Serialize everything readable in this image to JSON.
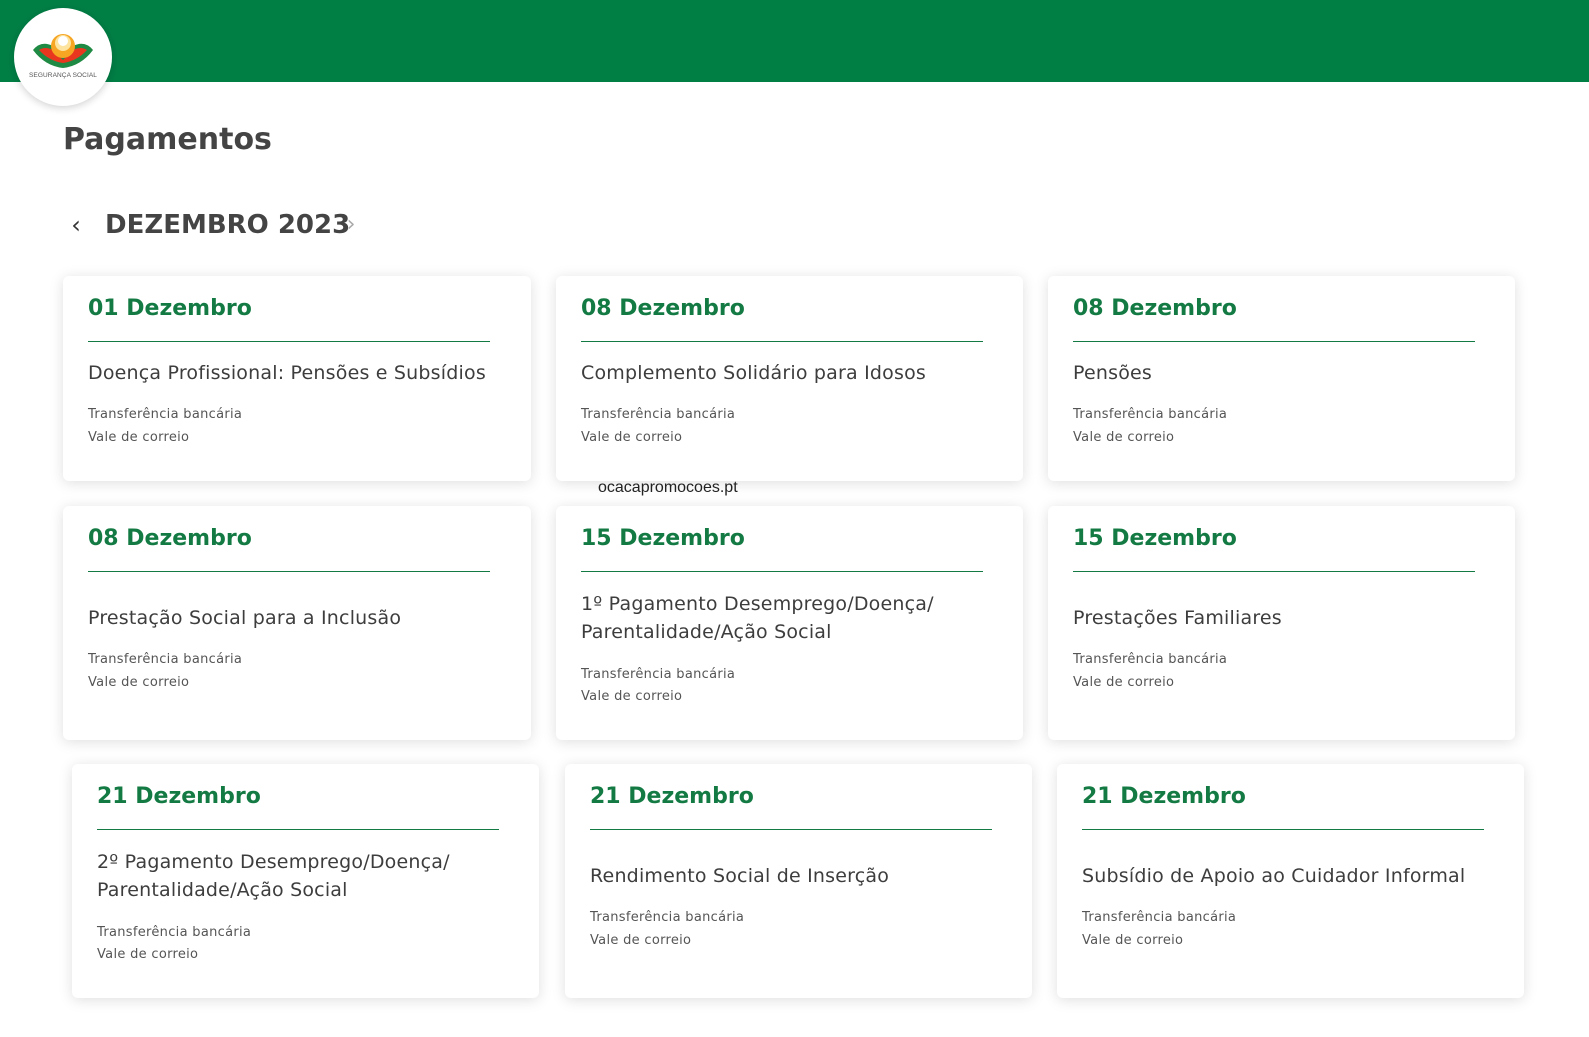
{
  "header": {
    "logo_text": "SEGURANÇA SOCIAL"
  },
  "page_title": "Pagamentos",
  "month_nav": {
    "prev_icon": "chevron-left-icon",
    "next_icon": "chevron-right-icon",
    "prev_glyph": "‹",
    "next_glyph": "›",
    "label": "DEZEMBRO 2023"
  },
  "watermark": "ocacapromocoes.pt",
  "colors": {
    "header_green": "#007f45",
    "accent_green": "#137a43"
  },
  "cards": [
    {
      "date": "01 Dezembro",
      "title": "Doença Profissional: Pensões e Subsídios",
      "methods": [
        "Transferência bancária",
        "Vale de correio"
      ]
    },
    {
      "date": "08 Dezembro",
      "title": "Complemento Solidário para Idosos",
      "methods": [
        "Transferência bancária",
        "Vale de correio"
      ]
    },
    {
      "date": "08 Dezembro",
      "title": "Pensões",
      "methods": [
        "Transferência bancária",
        "Vale de correio"
      ]
    },
    {
      "date": "08 Dezembro",
      "title": "Prestação Social para a Inclusão",
      "methods": [
        "Transferência bancária",
        "Vale de correio"
      ]
    },
    {
      "date": "15 Dezembro",
      "title": "1º Pagamento Desemprego/Doença/ Parentalidade/Ação Social",
      "methods": [
        "Transferência bancária",
        "Vale de correio"
      ]
    },
    {
      "date": "15 Dezembro",
      "title": "Prestações Familiares",
      "methods": [
        "Transferência bancária",
        "Vale de correio"
      ]
    },
    {
      "date": "21 Dezembro",
      "title": "2º Pagamento Desemprego/Doença/ Parentalidade/Ação Social",
      "methods": [
        "Transferência bancária",
        "Vale de correio"
      ]
    },
    {
      "date": "21 Dezembro",
      "title": "Rendimento Social de Inserção",
      "methods": [
        "Transferência bancária",
        "Vale de correio"
      ]
    },
    {
      "date": "21 Dezembro",
      "title": "Subsídio de Apoio ao Cuidador Informal",
      "methods": [
        "Transferência bancária",
        "Vale de correio"
      ]
    }
  ]
}
